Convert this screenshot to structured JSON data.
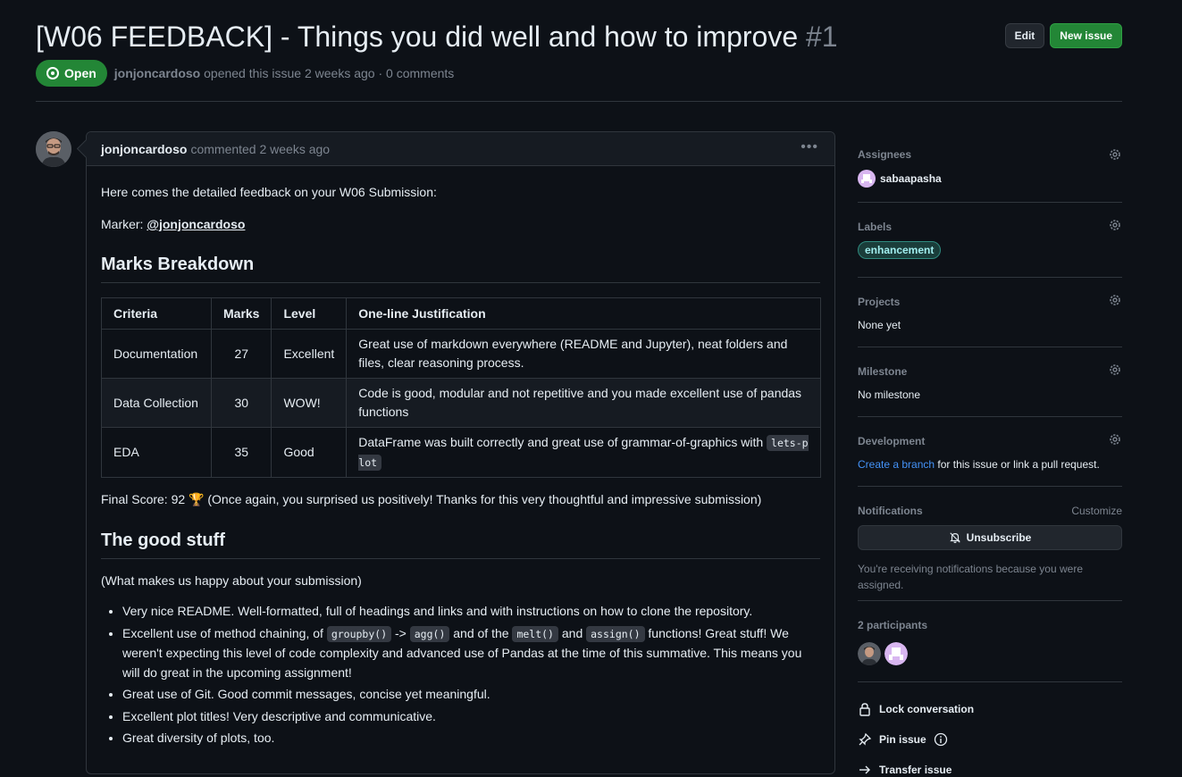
{
  "issue": {
    "title": "[W06 FEEDBACK] - Things you did well and how to improve",
    "number": "#1",
    "state": "Open",
    "author": "jonjoncardoso",
    "meta": "opened this issue 2 weeks ago · 0 comments",
    "edit_label": "Edit",
    "new_issue_label": "New issue"
  },
  "comment": {
    "author": "jonjoncardoso",
    "time": "commented 2 weeks ago",
    "intro": "Here comes the detailed feedback on your W06 Submission:",
    "marker_label": "Marker:",
    "marker_user": "@jonjoncardoso",
    "marks_heading": "Marks Breakdown",
    "table": {
      "headers": [
        "Criteria",
        "Marks",
        "Level",
        "One-line Justification"
      ],
      "rows": [
        {
          "criteria": "Documentation",
          "marks": "27",
          "level": "Excellent",
          "justification": "Great use of markdown everywhere (README and Jupyter), neat folders and files, clear reasoning process."
        },
        {
          "criteria": "Data Collection",
          "marks": "30",
          "level": "WOW!",
          "justification": "Code is good, modular and not repetitive and you made excellent use of pandas functions"
        },
        {
          "criteria": "EDA",
          "marks": "35",
          "level": "Good",
          "justification": "DataFrame was built correctly and great use of grammar-of-graphics with",
          "code": "lets-plot"
        }
      ]
    },
    "final_score": "Final Score: 92 🏆 (Once again, you surprised us positively! Thanks for this very thoughtful and impressive submission)",
    "good_heading": "The good stuff",
    "good_intro": "(What makes us happy about your submission)",
    "bullets": {
      "b1": "Very nice README. Well-formatted, full of headings and links and with instructions on how to clone the repository.",
      "b2_pre": "Excellent use of method chaining, of",
      "b2_code1": "groupby()",
      "b2_arrow": "->",
      "b2_code2": "agg()",
      "b2_mid": "and of the",
      "b2_code3": "melt()",
      "b2_and": "and",
      "b2_code4": "assign()",
      "b2_post": "functions! Great stuff! We weren't expecting this level of code complexity and advanced use of Pandas at the time of this summative. This means you will do great in the upcoming assignment!",
      "b3": "Great use of Git. Good commit messages, concise yet meaningful.",
      "b4": "Excellent plot titles! Very descriptive and communicative.",
      "b5": "Great diversity of plots, too."
    }
  },
  "sidebar": {
    "assignees_title": "Assignees",
    "assignee": "sabaapasha",
    "labels_title": "Labels",
    "label": "enhancement",
    "projects_title": "Projects",
    "projects_value": "None yet",
    "milestone_title": "Milestone",
    "milestone_value": "No milestone",
    "development_title": "Development",
    "development_link": "Create a branch",
    "development_text": "for this issue or link a pull request.",
    "notifications_title": "Notifications",
    "customize": "Customize",
    "unsubscribe": "Unsubscribe",
    "notifications_reason": "You're receiving notifications because you were assigned.",
    "participants_title": "2 participants",
    "lock": "Lock conversation",
    "pin": "Pin issue",
    "transfer": "Transfer issue"
  },
  "colors": {
    "background": "#0d1117",
    "open_green": "#238636",
    "link_blue": "#4493f8",
    "label_teal": "#a2eeef"
  }
}
